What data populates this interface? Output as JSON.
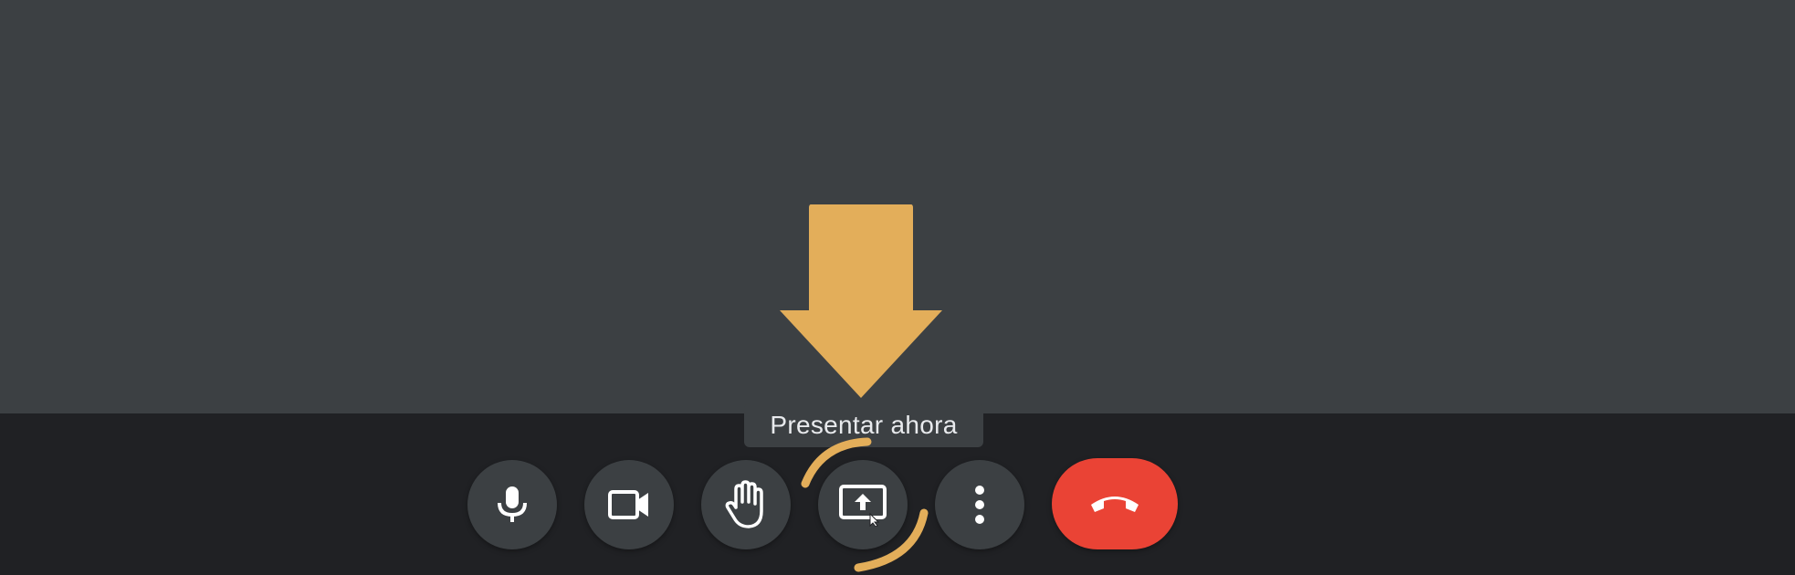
{
  "meeting": {
    "stage_color": "#3c4043",
    "bar_color": "#202124"
  },
  "controls": [
    {
      "id": "microphone",
      "icon": "microphone-icon"
    },
    {
      "id": "camera",
      "icon": "video-camera-icon"
    },
    {
      "id": "raise-hand",
      "icon": "hand-icon"
    },
    {
      "id": "present-now",
      "icon": "present-screen-icon"
    },
    {
      "id": "more-options",
      "icon": "more-vert-icon"
    },
    {
      "id": "leave-call",
      "icon": "call-end-icon"
    }
  ],
  "tooltip": {
    "label": "Presentar ahora"
  },
  "annotation": {
    "arrow_color": "#e3ae5a",
    "ring_color": "#e3ae5a",
    "leave_call_color": "#ea4335"
  }
}
